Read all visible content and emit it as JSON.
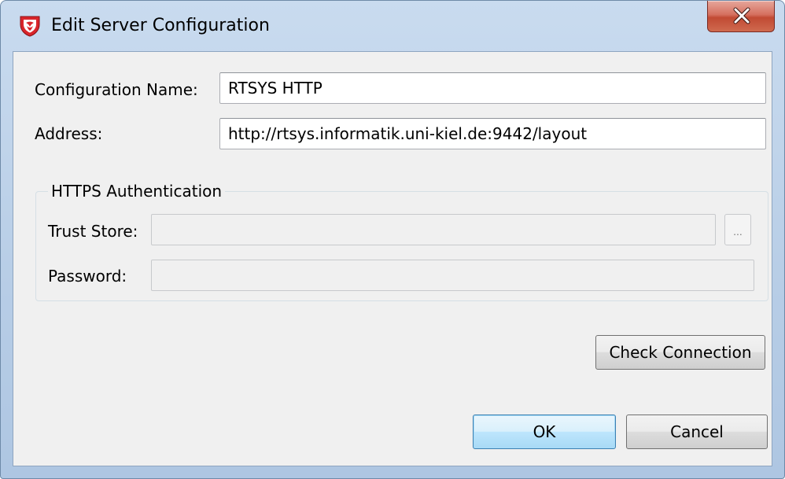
{
  "window": {
    "title": "Edit Server Configuration"
  },
  "form": {
    "config_name_label": "Configuration Name:",
    "config_name_value": "RTSYS HTTP",
    "address_label": "Address:",
    "address_value": "http://rtsys.informatik.uni-kiel.de:9442/layout"
  },
  "https_group": {
    "title": "HTTPS Authentication",
    "trust_store_label": "Trust Store:",
    "trust_store_value": "",
    "browse_label": "...",
    "password_label": "Password:",
    "password_value": ""
  },
  "buttons": {
    "check_connection": "Check Connection",
    "ok": "OK",
    "cancel": "Cancel"
  },
  "icons": {
    "app": "shield-icon",
    "close": "close-icon"
  },
  "colors": {
    "shield_red": "#d9252b",
    "default_button_border": "#3c7fb1"
  }
}
